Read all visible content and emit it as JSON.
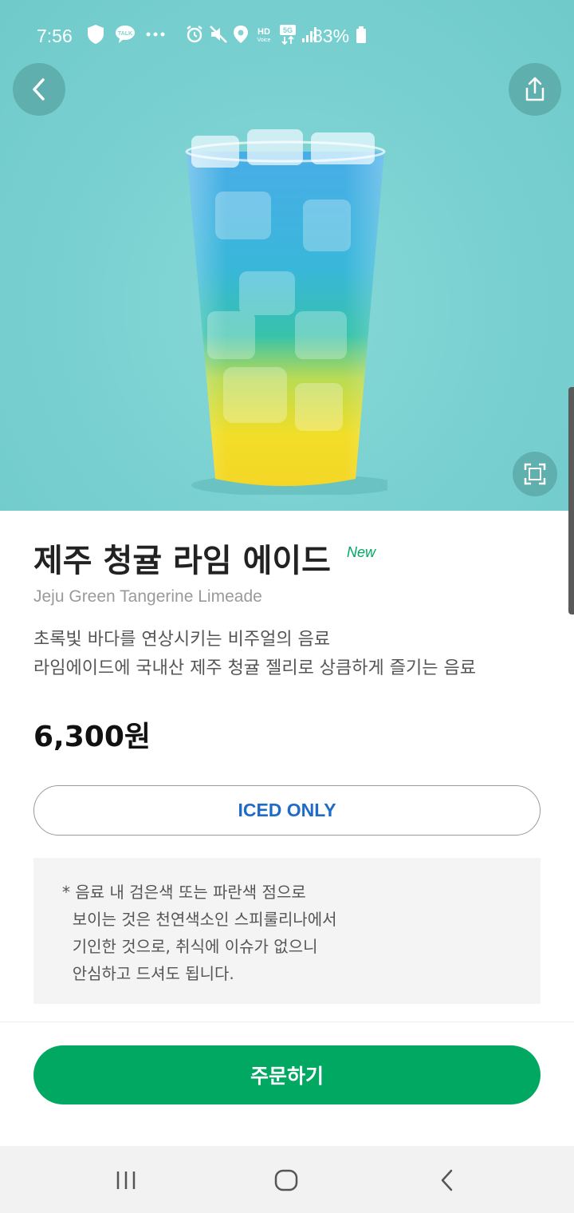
{
  "status_bar": {
    "time": "7:56",
    "battery": "83%",
    "icons": [
      "shield-icon",
      "talk-icon",
      "more-dots-icon",
      "alarm-icon",
      "mute-icon",
      "location-icon",
      "hd-voice-icon",
      "5g-icon",
      "signal-icon",
      "battery-icon"
    ]
  },
  "hero": {
    "background_color": "#7fd3d3",
    "back_icon": "chevron-left-icon",
    "share_icon": "share-icon",
    "zoom_icon": "fullscreen-icon"
  },
  "product": {
    "name_ko": "제주 청귤 라임 에이드",
    "badge": "New",
    "name_en": "Jeju Green Tangerine Limeade",
    "description_line1": "초록빛 바다를 연상시키는 비주얼의 음료",
    "description_line2": "라임에이드에 국내산 제주 청귤 젤리로 상큼하게 즐기는 음료",
    "price": "6,300원",
    "temperature_option": "ICED ONLY",
    "notice": "* 음료 내 검은색 또는 파란색 점으로\n  보이는 것은 천연색소인 스피룰리나에서\n  기인한 것으로, 취식에 이슈가 없으니\n  안심하고 드셔도 됩니다."
  },
  "actions": {
    "order_label": "주문하기"
  },
  "colors": {
    "brand_green": "#00a862",
    "option_blue": "#1f6cc8"
  },
  "nav": {
    "icons": [
      "recent-apps-icon",
      "home-icon",
      "back-icon"
    ]
  }
}
